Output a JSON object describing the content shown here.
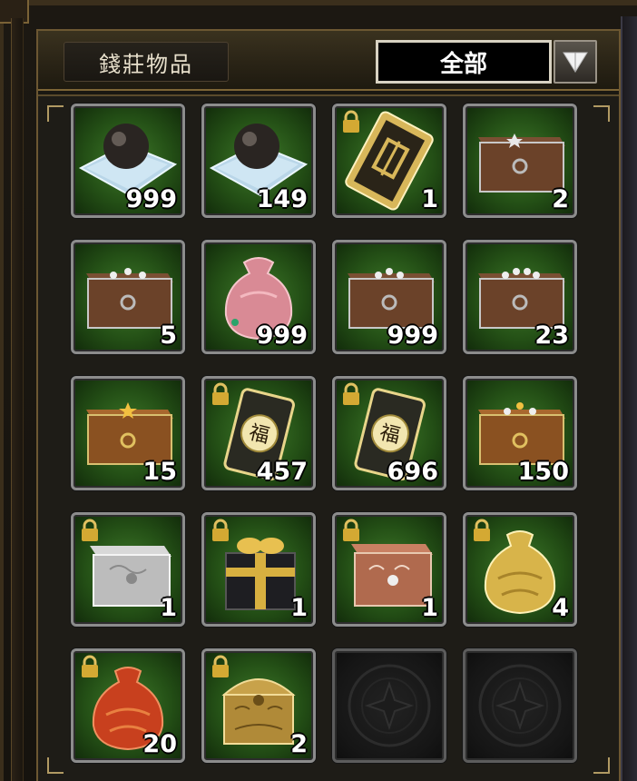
{
  "header": {
    "title": "錢莊物品",
    "filter_value": "全部",
    "filter_button_icon": "triangle-down-icon"
  },
  "colors": {
    "slot_green": "#2f6a1e",
    "frame_gold": "#b19a63",
    "slot_border": "#8c8c8c"
  },
  "slots": [
    {
      "icon": "pearl-on-cushion-icon",
      "quantity": "999",
      "locked": false
    },
    {
      "icon": "pearl-on-cushion-icon",
      "quantity": "149",
      "locked": false
    },
    {
      "icon": "gold-ticket-icon",
      "quantity": "1",
      "locked": true
    },
    {
      "icon": "star-chest-icon",
      "quantity": "2",
      "locked": false
    },
    {
      "icon": "three-star-chest-icon",
      "quantity": "5",
      "locked": false
    },
    {
      "icon": "pink-pouch-icon",
      "quantity": "999",
      "locked": false
    },
    {
      "icon": "three-star-chest-icon",
      "quantity": "999",
      "locked": false
    },
    {
      "icon": "four-star-chest-icon",
      "quantity": "23",
      "locked": false
    },
    {
      "icon": "gold-star-chest-icon",
      "quantity": "15",
      "locked": false
    },
    {
      "icon": "fortune-charm-icon",
      "quantity": "457",
      "locked": true
    },
    {
      "icon": "fortune-charm-icon",
      "quantity": "696",
      "locked": true
    },
    {
      "icon": "multi-star-chest-icon",
      "quantity": "150",
      "locked": false
    },
    {
      "icon": "silver-chest-icon",
      "quantity": "1",
      "locked": true
    },
    {
      "icon": "gift-box-icon",
      "quantity": "1",
      "locked": true
    },
    {
      "icon": "bronze-chest-icon",
      "quantity": "1",
      "locked": true
    },
    {
      "icon": "gold-sack-icon",
      "quantity": "4",
      "locked": true
    },
    {
      "icon": "red-sack-icon",
      "quantity": "20",
      "locked": true
    },
    {
      "icon": "gold-treasure-chest-icon",
      "quantity": "2",
      "locked": true
    },
    {
      "icon": "empty-slot-icon",
      "quantity": "",
      "locked": false
    },
    {
      "icon": "empty-slot-icon",
      "quantity": "",
      "locked": false
    }
  ]
}
